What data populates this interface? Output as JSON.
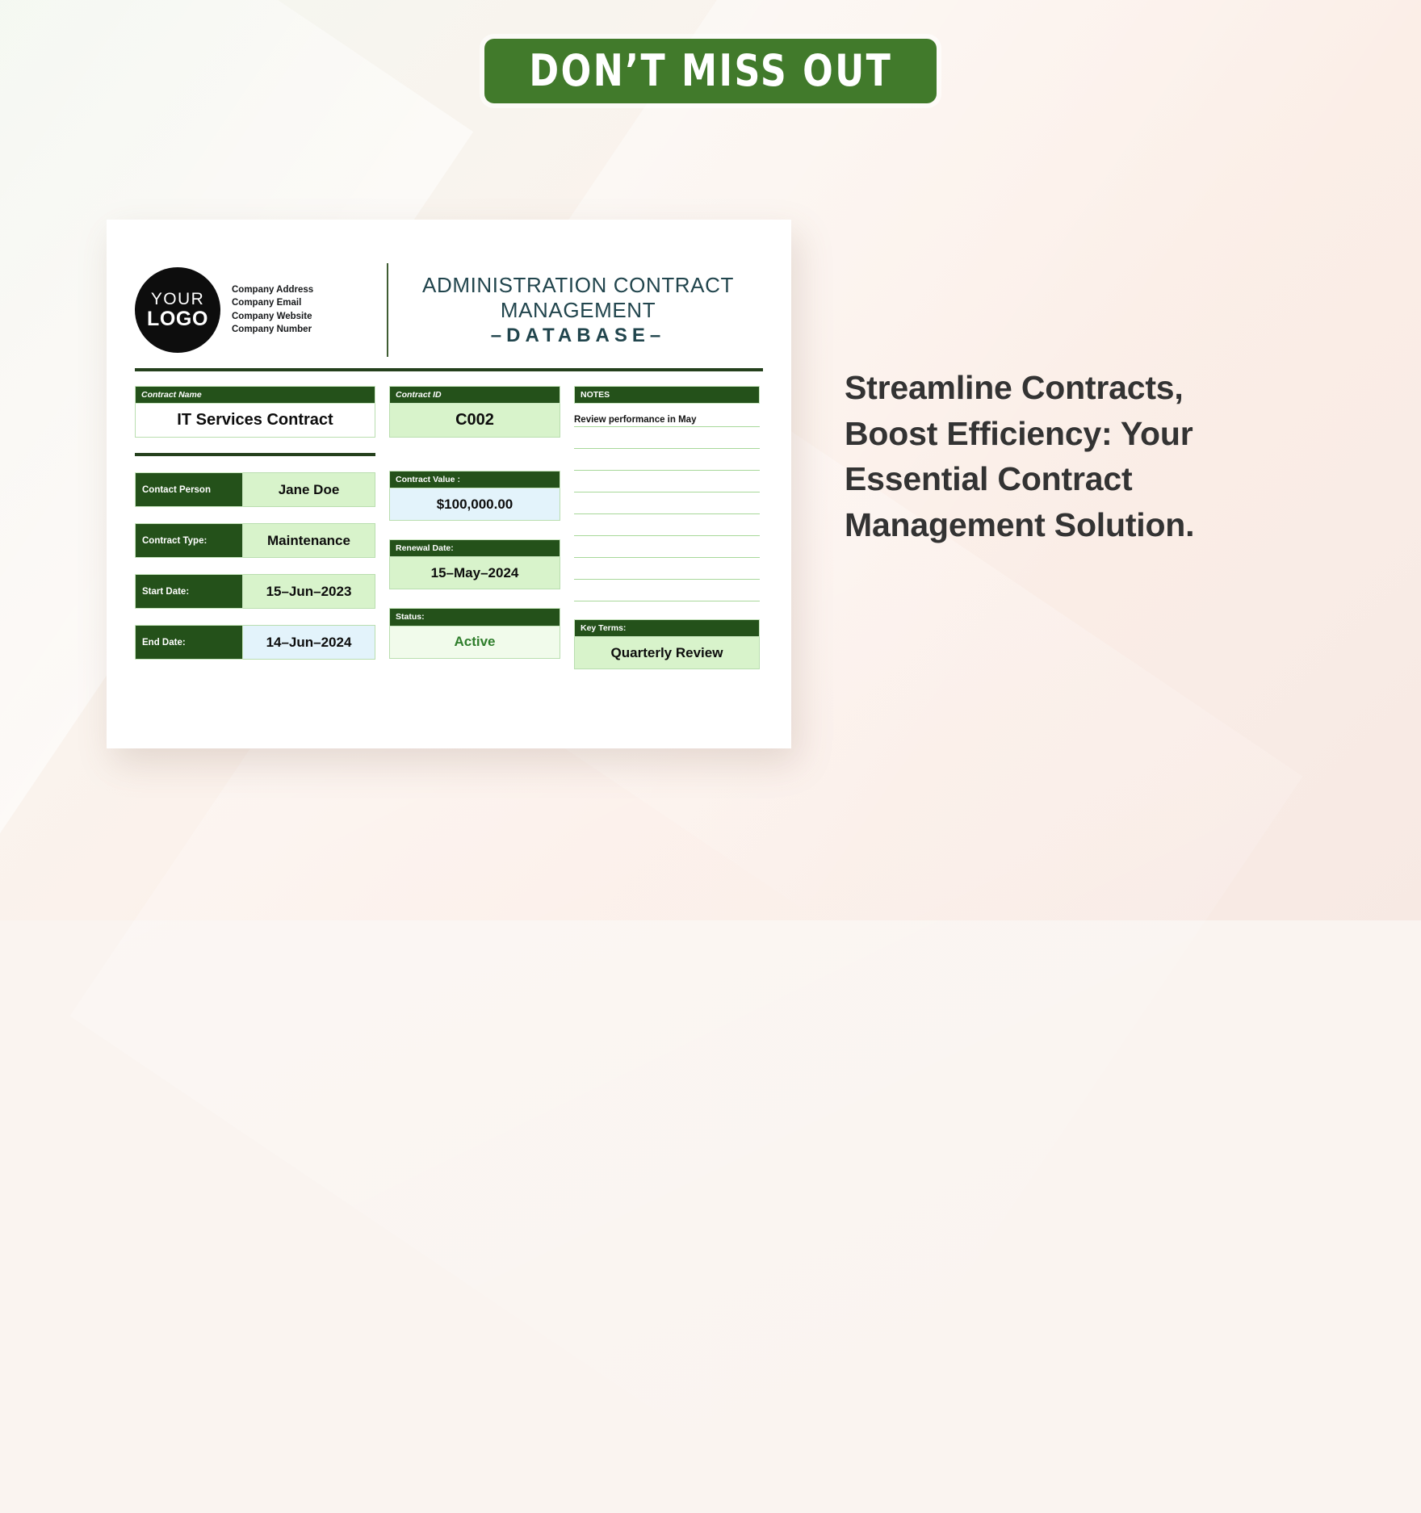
{
  "banner": {
    "text": "DON’T MISS OUT"
  },
  "document": {
    "logo": {
      "line1": "YOUR",
      "line2": "LOGO"
    },
    "company": [
      "Company Address",
      "Company Email",
      "Company Website",
      "Company Number"
    ],
    "title": {
      "line1": "ADMINISTRATION CONTRACT",
      "line2": "MANAGEMENT",
      "subtitle": "–DATABASE–"
    },
    "fields": {
      "contract_name": {
        "label": "Contract Name",
        "value": "IT Services Contract"
      },
      "contract_id": {
        "label": "Contract ID",
        "value": "C002"
      },
      "contact_person": {
        "label": "Contact Person",
        "value": "Jane Doe"
      },
      "contract_type": {
        "label": "Contract Type:",
        "value": "Maintenance"
      },
      "start_date": {
        "label": "Start Date:",
        "value": "15–Jun–2023"
      },
      "end_date": {
        "label": "End Date:",
        "value": "14–Jun–2024"
      },
      "contract_value": {
        "label": "Contract Value :",
        "value": "$100,000.00"
      },
      "renewal_date": {
        "label": "Renewal Date:",
        "value": "15–May–2024"
      },
      "status": {
        "label": "Status:",
        "value": "Active"
      },
      "key_terms": {
        "label": "Key Terms:",
        "value": "Quarterly Review"
      }
    },
    "notes": {
      "label": "NOTES",
      "entries": [
        "Review performance in May",
        "",
        "",
        "",
        "",
        "",
        "",
        "",
        ""
      ]
    }
  },
  "marketing": {
    "lines": [
      "Streamline Contracts,",
      "Boost Efficiency: Your",
      "Essential Contract",
      "Management Solution."
    ]
  },
  "colors": {
    "banner_green": "#417a2b",
    "header_green": "#24511a",
    "divider_green": "#24401c",
    "value_green_bg": "#d8f3cb",
    "value_blue_bg": "#e3f3fb",
    "title_teal": "#21454d",
    "status_green_text": "#2e7d2b"
  }
}
